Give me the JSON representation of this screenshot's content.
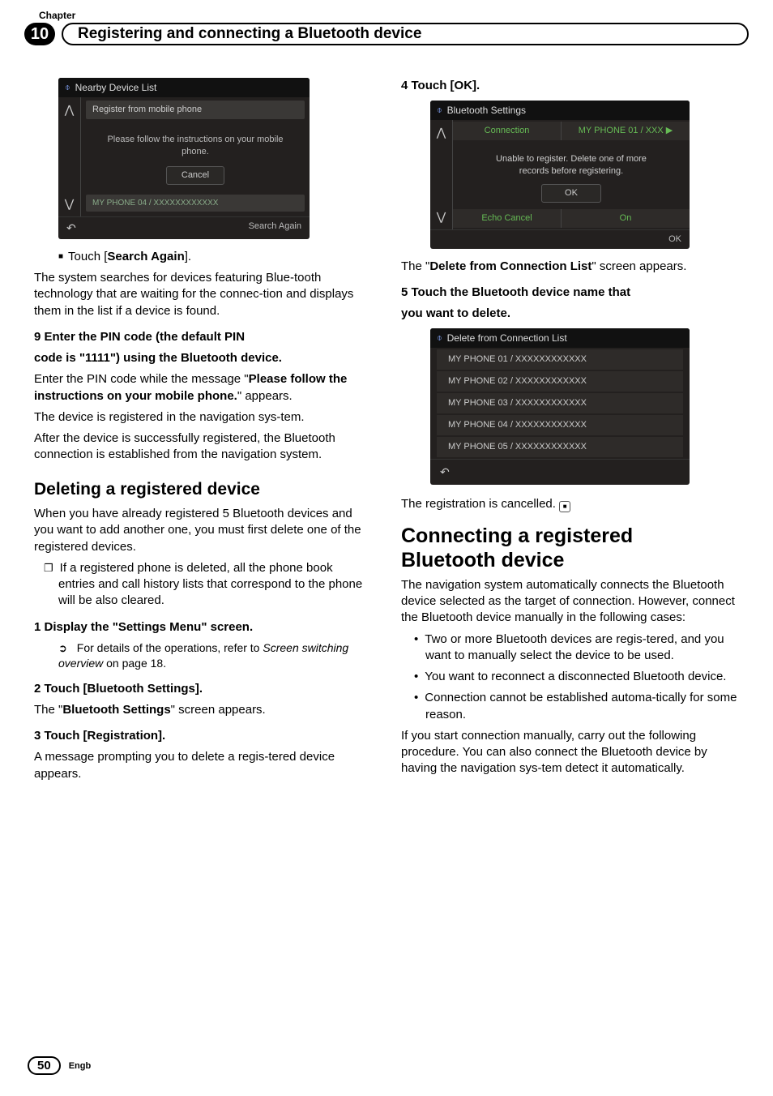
{
  "header": {
    "chapter_label": "Chapter",
    "chapter_num": "10",
    "title": "Registering and connecting a Bluetooth device"
  },
  "shot1": {
    "title": "Nearby Device List",
    "register": "Register from mobile phone",
    "msg1": "Please follow the instructions on your mobile",
    "msg2": "phone.",
    "cancel": "Cancel",
    "device": "MY PHONE 04 / XXXXXXXXXXXX",
    "search_again": "Search Again"
  },
  "left": {
    "touch_search": "Touch [",
    "search_again_bold": "Search Again",
    "touch_search_end": "].",
    "p1": "The system searches for devices featuring Blue-tooth technology that are waiting for the connec-tion and displays them in the list if a device is found.",
    "step9a": "9    Enter the PIN code (the default PIN",
    "step9b": "code is \"1111\") using the Bluetooth device.",
    "p2a": "Enter the PIN code while the message \"",
    "p2b": "Please follow the instructions on your mobile phone.",
    "p2c": "\" appears.",
    "p3": "The device is registered in the navigation sys-tem.",
    "p4": "After the device is successfully registered, the Bluetooth connection is established from the navigation system.",
    "h2_delete": "Deleting a registered device",
    "p5": "When you have already registered 5 Bluetooth devices and you want to add another one, you must first delete one of the registered devices.",
    "note1": "If a registered phone is deleted, all the phone book entries and call history lists that correspond to the phone will be also cleared.",
    "step1": "1    Display the \"Settings Menu\" screen.",
    "ref1a": "For details of the operations, refer to ",
    "ref1b": "Screen switching overview",
    "ref1c": " on page 18.",
    "step2": "2    Touch [Bluetooth Settings].",
    "p6a": "The \"",
    "p6b": "Bluetooth Settings",
    "p6c": "\" screen appears.",
    "step3": "3    Touch [Registration].",
    "p7": "A message prompting you to delete a regis-tered device appears."
  },
  "right": {
    "step4": "4    Touch [OK].",
    "shot2": {
      "title": "Bluetooth Settings",
      "connection": "Connection",
      "conn_val": "MY PHONE 01 / XXX",
      "msg1": "Unable to register.  Delete one of more",
      "msg2": "records before registering.",
      "ok": "OK",
      "echo": "Echo Cancel",
      "on": "On",
      "ok2": "OK"
    },
    "p1a": "The \"",
    "p1b": "Delete from Connection List",
    "p1c": "\" screen appears.",
    "step5a": "5    Touch the Bluetooth device name that",
    "step5b": "you want to delete.",
    "shot3": {
      "title": "Delete from Connection List",
      "d1": "MY PHONE 01 / XXXXXXXXXXXX",
      "d2": "MY PHONE 02 / XXXXXXXXXXXX",
      "d3": "MY PHONE 03 / XXXXXXXXXXXX",
      "d4": "MY PHONE 04 / XXXXXXXXXXXX",
      "d5": "MY PHONE 05 / XXXXXXXXXXXX"
    },
    "p2": "The registration is cancelled.",
    "h1a": "Connecting a registered",
    "h1b": "Bluetooth device",
    "p3": "The navigation system automatically connects the Bluetooth device selected as the target of connection. However, connect the Bluetooth device manually in the following cases:",
    "b1": "Two or more Bluetooth devices are regis-tered, and you want to manually select the device to be used.",
    "b2": "You want to reconnect a disconnected Bluetooth device.",
    "b3": "Connection cannot be established automa-tically for some reason.",
    "p4": "If you start connection manually, carry out the following procedure. You can also connect the Bluetooth device by having the navigation sys-tem detect it automatically."
  },
  "footer": {
    "page": "50",
    "lang": "Engb"
  }
}
